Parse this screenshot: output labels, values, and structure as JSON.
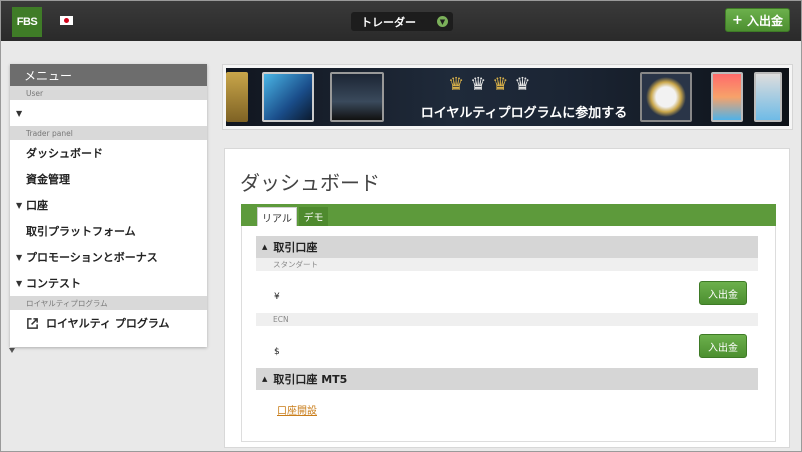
{
  "header": {
    "logo_text": "FBS",
    "account_selector": "トレーダー",
    "deposit_button": "入出金"
  },
  "sidebar": {
    "menu_title": "メニュー",
    "user_section": "User",
    "trader_section": "Trader panel",
    "items": [
      {
        "label": "ダッシュボード"
      },
      {
        "label": "資金管理"
      },
      {
        "label": "口座"
      },
      {
        "label": "取引プラットフォーム"
      },
      {
        "label": "プロモーションとボーナス"
      },
      {
        "label": "コンテスト"
      }
    ],
    "loyalty_section": "ロイヤルティプログラム",
    "loyalty_item": "ロイヤルティ プログラム"
  },
  "banner": {
    "text": "ロイヤルティプログラムに参加する"
  },
  "main": {
    "title": "ダッシュボード",
    "tabs": [
      {
        "label": "リアル"
      },
      {
        "label": "デモ"
      }
    ],
    "groups": [
      {
        "title": "取引口座",
        "accounts": [
          {
            "type": "スタンダート",
            "balance": "¥",
            "button": "入出金"
          },
          {
            "type": "ECN",
            "balance": "$",
            "button": "入出金"
          }
        ]
      },
      {
        "title": "取引口座 MT5",
        "link": "口座開設"
      }
    ]
  },
  "colors": {
    "brand_green": "#5d9a3b",
    "topbar": "#2e2e2e",
    "link": "#c97d1a"
  }
}
